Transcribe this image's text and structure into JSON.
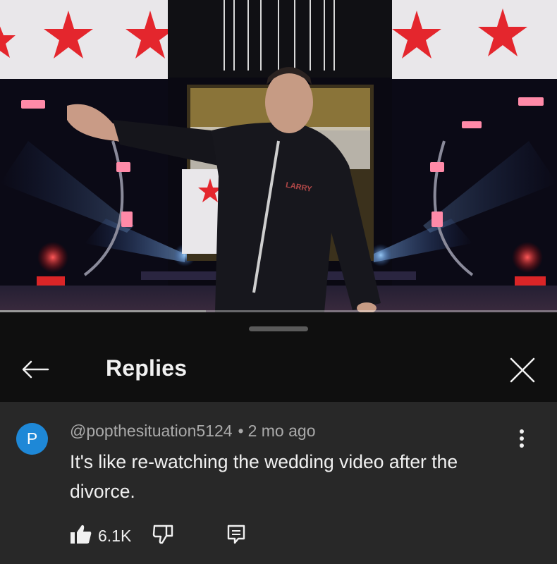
{
  "video": {
    "progress_fraction": 0.37,
    "shirt_logo": "LARRY"
  },
  "header": {
    "title": "Replies",
    "back_icon": "arrow-left-icon",
    "close_icon": "close-icon"
  },
  "comment": {
    "avatar_letter": "P",
    "avatar_color": "#1e88d7",
    "author": "@popthesituation5124",
    "separator": "•",
    "timestamp": "2 mo ago",
    "text": "It's like re-watching the wedding video after the divorce.",
    "like_count": "6.1K",
    "icons": {
      "like": "thumbs-up-icon",
      "dislike": "thumbs-down-icon",
      "reply": "reply-icon",
      "more": "more-vertical-icon"
    }
  },
  "colors": {
    "background": "#0f0f0f",
    "comment_background": "#282828",
    "primary_text": "#f1f1f1",
    "secondary_text": "#aaaaaa",
    "star_red": "#e4262d"
  }
}
